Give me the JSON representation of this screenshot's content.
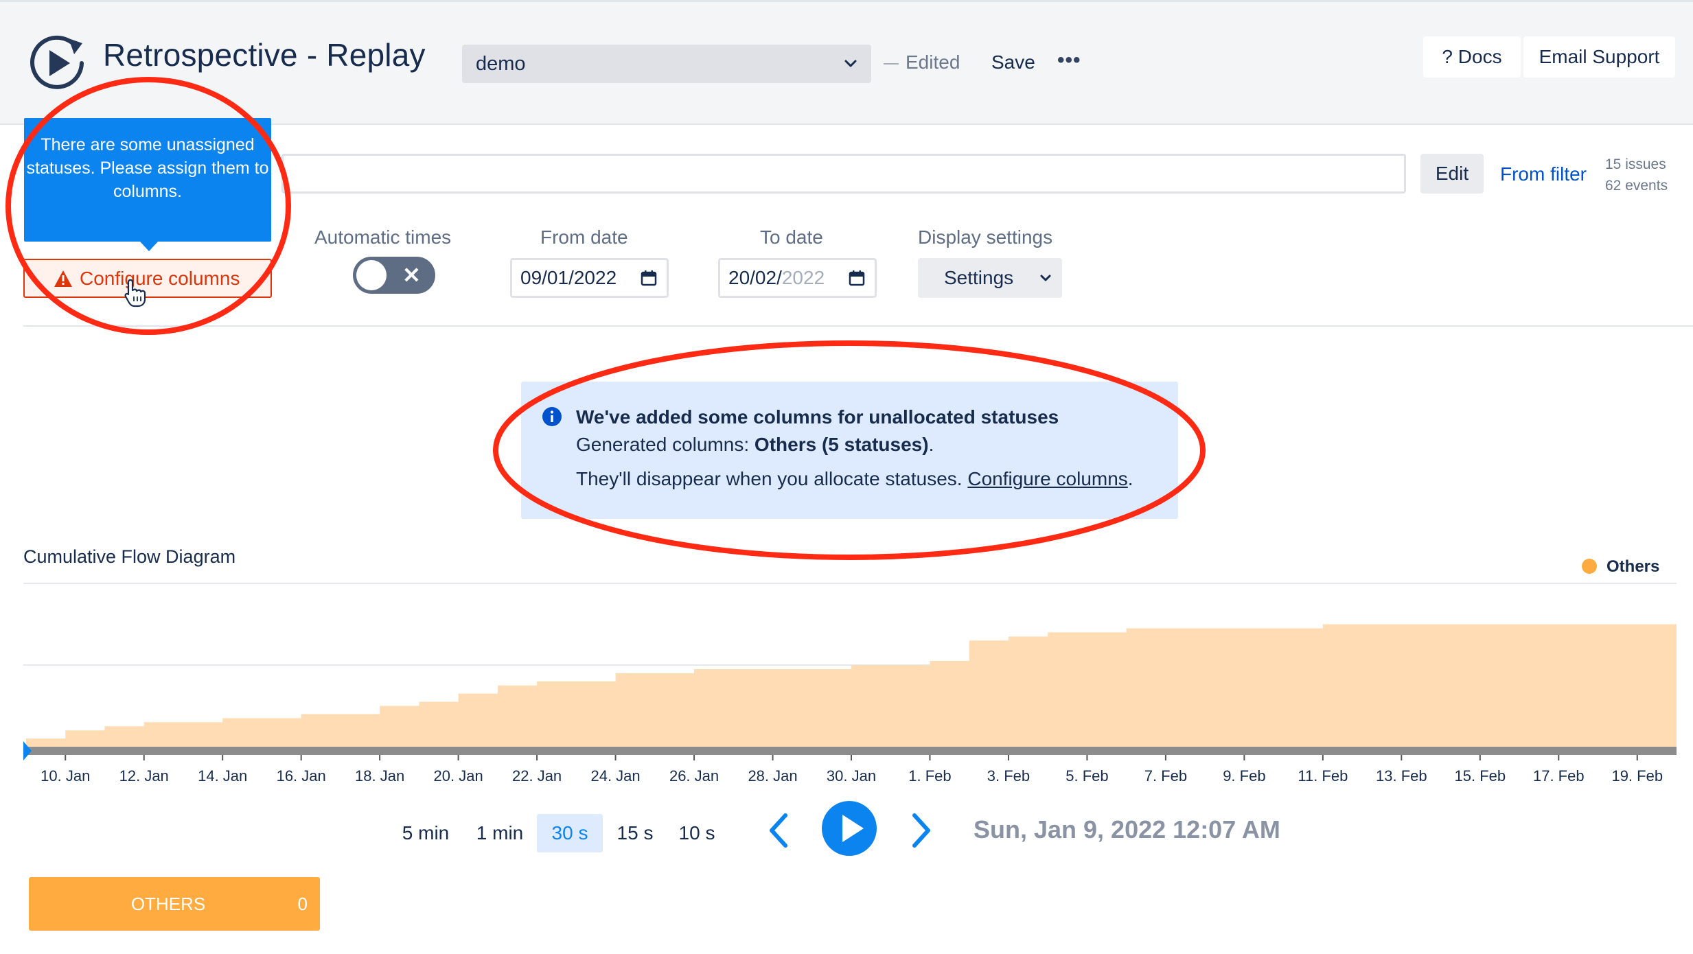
{
  "header": {
    "title": "Retrospective - Replay",
    "preset": "demo",
    "edited": "Edited",
    "save": "Save",
    "more": "•••",
    "docs": "? Docs",
    "email_support": "Email Support"
  },
  "filter": {
    "edit": "Edit",
    "from_filter": "From filter",
    "issues": "15 issues",
    "events": "62 events"
  },
  "tooltip": {
    "text": "There are some unassigned statuses. Please assign them to columns."
  },
  "controls": {
    "configure_columns": "Configure columns",
    "automatic_times_label": "Automatic times",
    "toggle_glyph": "✕",
    "from_date_label": "From date",
    "from_date_value": "09/01/2022",
    "to_date_label": "To date",
    "to_date_day_month": "20/02/",
    "to_date_year": "2022",
    "display_settings_label": "Display settings",
    "settings": "Settings"
  },
  "info": {
    "title": "We've added some columns for unallocated statuses",
    "generated_prefix": "Generated columns: ",
    "generated_bold": "Others (5 statuses)",
    "generated_suffix": ".",
    "note_prefix": "They'll disappear when you allocate statuses. ",
    "note_link": "Configure columns",
    "note_suffix": "."
  },
  "chart_data": {
    "type": "area",
    "title": "Cumulative Flow Diagram",
    "series": [
      {
        "name": "Others",
        "color": "#ffdcb3",
        "x": [
          "9. Jan",
          "10. Jan",
          "11. Jan",
          "12. Jan",
          "13. Jan",
          "14. Jan",
          "15. Jan",
          "16. Jan",
          "17. Jan",
          "18. Jan",
          "19. Jan",
          "20. Jan",
          "21. Jan",
          "22. Jan",
          "23. Jan",
          "24. Jan",
          "25. Jan",
          "26. Jan",
          "27. Jan",
          "28. Jan",
          "29. Jan",
          "30. Jan",
          "31. Jan",
          "1. Feb",
          "2. Feb",
          "3. Feb",
          "4. Feb",
          "5. Feb",
          "6. Feb",
          "7. Feb",
          "8. Feb",
          "9. Feb",
          "10. Feb",
          "11. Feb",
          "12. Feb",
          "13. Feb",
          "14. Feb",
          "15. Feb",
          "16. Feb",
          "17. Feb",
          "18. Feb",
          "19. Feb",
          "20. Feb"
        ],
        "values": [
          1,
          2,
          2.5,
          3,
          3,
          3.5,
          3.5,
          4,
          4,
          5,
          5.5,
          6.5,
          7.5,
          8,
          8,
          9,
          9,
          9.5,
          9.5,
          9.5,
          9.5,
          10,
          10,
          10.5,
          13,
          13.5,
          14,
          14,
          14.5,
          14.5,
          14.5,
          14.5,
          14.5,
          15,
          15,
          15,
          15,
          15,
          15,
          15,
          15,
          15,
          15
        ]
      }
    ],
    "x_tick_labels": [
      "10. Jan",
      "12. Jan",
      "14. Jan",
      "16. Jan",
      "18. Jan",
      "20. Jan",
      "22. Jan",
      "24. Jan",
      "26. Jan",
      "28. Jan",
      "30. Jan",
      "1. Feb",
      "3. Feb",
      "5. Feb",
      "7. Feb",
      "9. Feb",
      "11. Feb",
      "13. Feb",
      "15. Feb",
      "17. Feb",
      "19. Feb"
    ],
    "legend": {
      "position": "top-right",
      "entries": [
        "Others"
      ]
    },
    "grid": true,
    "ylim": [
      0,
      20
    ]
  },
  "playback": {
    "speeds": [
      "5 min",
      "1 min",
      "30 s",
      "15 s",
      "10 s"
    ],
    "active_speed": "30 s",
    "datetime": "Sun, Jan 9, 2022 12:07 AM"
  },
  "board": {
    "column_name": "OTHERS",
    "column_count": "0"
  },
  "colors": {
    "accent": "#0c84f0",
    "annotation": "#ff2a14",
    "others": "#ffab40",
    "warning": "#de350b"
  }
}
